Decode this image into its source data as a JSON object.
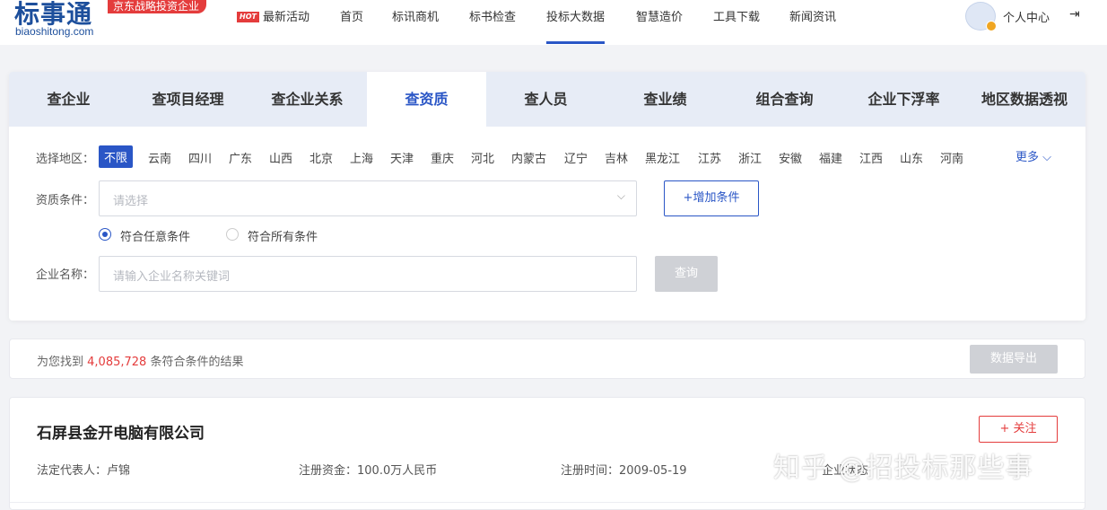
{
  "header": {
    "logo_text": "标事通",
    "logo_sub": "biaoshitong.com",
    "logo_tag": "京东战略投资企业",
    "nav": [
      {
        "label": "最新活动",
        "hot": "HOT"
      },
      {
        "label": "首页"
      },
      {
        "label": "标讯商机"
      },
      {
        "label": "标书检查"
      },
      {
        "label": "投标大数据",
        "active": true
      },
      {
        "label": "智慧造价"
      },
      {
        "label": "工具下载"
      },
      {
        "label": "新闻资讯"
      }
    ],
    "user_label": "个人中心",
    "logout_icon": "⇥"
  },
  "tabs": [
    "查企业",
    "查项目经理",
    "查企业关系",
    "查资质",
    "查人员",
    "查业绩",
    "组合查询",
    "企业下浮率",
    "地区数据透视"
  ],
  "active_tab": "查资质",
  "filters": {
    "region_label": "选择地区：",
    "regions": [
      "不限",
      "云南",
      "四川",
      "广东",
      "山西",
      "北京",
      "上海",
      "天津",
      "重庆",
      "河北",
      "内蒙古",
      "辽宁",
      "吉林",
      "黑龙江",
      "江苏",
      "浙江",
      "安徽",
      "福建",
      "江西",
      "山东",
      "河南"
    ],
    "more": "更多 ⌵",
    "qual_label": "资质条件：",
    "qual_placeholder": "请选择",
    "add_condition": "+增加条件",
    "match_any": "符合任意条件",
    "match_all": "符合所有条件",
    "company_label": "企业名称：",
    "company_placeholder": "请输入企业名称关键词",
    "search": "查询"
  },
  "result": {
    "prefix": "为您找到 ",
    "count": "4,085,728",
    "suffix": " 条符合条件的结果",
    "export": "数据导出"
  },
  "company": {
    "name": "石屏县金开电脑有限公司",
    "follow": "+ 关注",
    "legal_rep": "法定代表人：卢锦",
    "capital": "注册资金：100.0万人民币",
    "reg_date": "注册时间：2009-05-19",
    "status": "企业状态"
  },
  "watermark": "知乎 @招投标那些事",
  "colors": {
    "accent": "#2a56c6",
    "red": "#e43c3c"
  }
}
